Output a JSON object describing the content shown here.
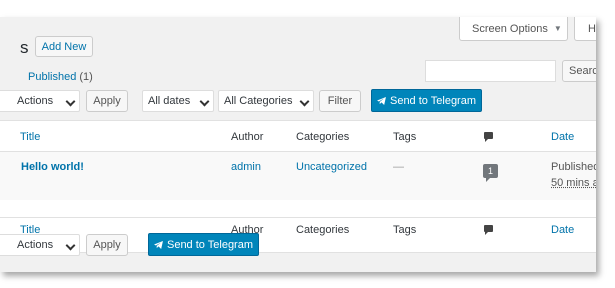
{
  "top": {
    "screen_options": "Screen Options",
    "help_partial": "H",
    "page_title_partial": "s",
    "add_new": "Add New"
  },
  "subsubsub": {
    "published": "Published",
    "published_count": "(1)"
  },
  "search": {
    "value": "",
    "button": "Search"
  },
  "tablenav_top": {
    "bulk_actions": "Actions",
    "apply": "Apply",
    "dates_filter": "All dates",
    "category_filter": "All Categories",
    "filter": "Filter",
    "telegram": "Send to Telegram"
  },
  "columns": {
    "title": "Title",
    "author": "Author",
    "categories": "Categories",
    "tags": "Tags",
    "date": "Date"
  },
  "rows": [
    {
      "title": "Hello world!",
      "author": "admin",
      "categories": "Uncategorized",
      "tags": "—",
      "comments": "1",
      "date_status": "Published",
      "date_ago": "50 mins a"
    }
  ],
  "tablenav_bottom": {
    "bulk_actions": "Actions",
    "apply": "Apply",
    "telegram": "Send to Telegram"
  },
  "colors": {
    "accent": "#0073aa",
    "telegram_button": "#0085ba",
    "background": "#f1f1f1"
  }
}
